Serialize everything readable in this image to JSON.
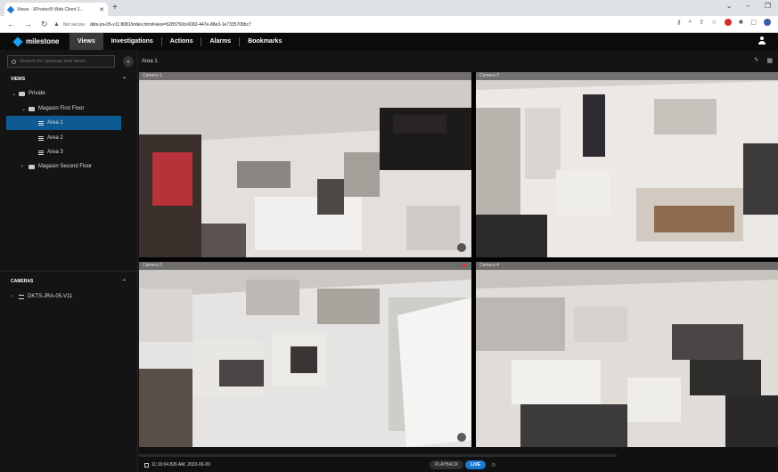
{
  "browser": {
    "tab_title": "Views - XProtect® Web Client 2...",
    "url_warning": "Not secure",
    "url": "dkts-jra-05-v11:8081/index.html#view=5285750d-6082-447e-88e3-1e7335708bc7"
  },
  "app": {
    "logo_text": "milestone",
    "nav": [
      "Views",
      "Investigations",
      "Actions",
      "Alarms",
      "Bookmarks"
    ],
    "active_nav": "Views"
  },
  "sidebar": {
    "search_placeholder": "Search for cameras and views...",
    "views_header": "VIEWS",
    "tree": [
      {
        "label": "Private"
      },
      {
        "label": "Magasin First Floor"
      },
      {
        "label": "Area 1"
      },
      {
        "label": "Area 2"
      },
      {
        "label": "Area 3"
      },
      {
        "label": "Magasin Second Floor"
      }
    ],
    "cameras_header": "CAMERAS",
    "camera_tree": [
      {
        "label": "DKTS-JRA-05-V11"
      }
    ]
  },
  "view": {
    "title": "Area 1",
    "cameras": [
      {
        "name": "Camera 1"
      },
      {
        "name": "Camera 3"
      },
      {
        "name": "Camera 2"
      },
      {
        "name": "Camera 4"
      }
    ]
  },
  "bottom": {
    "timestamp": "11:16:04.826 AM, 2023-06-09",
    "playback_label": "PLAYBACK",
    "live_label": "LIVE"
  },
  "colors": {
    "accent": "#1b78d4",
    "selection": "#0e5b93",
    "background": "#141414"
  }
}
